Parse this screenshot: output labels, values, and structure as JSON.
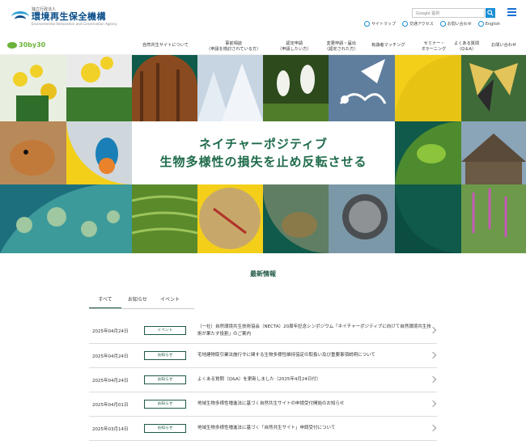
{
  "header": {
    "org_label": "独立行政法人",
    "org_name": "環境再生保全機構",
    "org_name_en": "Environmental Restoration and Conservation Agency",
    "search_placeholder": "Google 提供",
    "utility_links": [
      {
        "label": "サイトマップ",
        "icon": "sitemap-icon"
      },
      {
        "label": "交通アクセス",
        "icon": "map-pin-icon"
      },
      {
        "label": "お問い合わせ",
        "icon": "mail-icon"
      },
      {
        "label": "English",
        "icon": "globe-icon"
      }
    ]
  },
  "nav": {
    "logo_text": "30by30",
    "items": [
      {
        "label": "自然共生サイトについて",
        "sub": ""
      },
      {
        "label": "事前相談",
        "sub": "（申請を検討されている方）"
      },
      {
        "label": "認定申請",
        "sub": "（申請したい方）"
      },
      {
        "label": "変更申請・届出",
        "sub": "（認定された方）"
      },
      {
        "label": "有識者マッチング",
        "sub": ""
      },
      {
        "label": "セミナー・",
        "sub": "Eラーニング"
      },
      {
        "label": "よくある質問",
        "sub": "（Q＆A）"
      },
      {
        "label": "お問い合わせ",
        "sub": ""
      }
    ]
  },
  "hero": {
    "line1": "ネイチャーポジティブ",
    "line2": "生物多様性の損失を止め反転させる"
  },
  "news": {
    "title": "最新情報",
    "tabs": [
      "すべて",
      "お知らせ",
      "イベント"
    ],
    "items": [
      {
        "date": "2025年04月24日",
        "badge": "イベント",
        "text": "（一社）自然環境共生技術協会（NECTA）20周年記念シンポジウム「ネイチャーポジティブに向けて自然環境共生技術が果たす役割」のご案内"
      },
      {
        "date": "2025年04月24日",
        "badge": "お知らせ",
        "text": "宅地建物取引業法施行令に関する生物多様性維持協定の取扱い及び重要事項説明について"
      },
      {
        "date": "2025年04月24日",
        "badge": "お知らせ",
        "text": "よくある質問（Q&A）を更新しました（2025年4月24日付）"
      },
      {
        "date": "2025年04月01日",
        "badge": "お知らせ",
        "text": "地域生物多様性増進法に基づく自然共生サイトの申請受付開始のお知らせ"
      },
      {
        "date": "2025年03月14日",
        "badge": "お知らせ",
        "text": "地域生物多様性増進法に基づく「自然共生サイト」申請受付について"
      }
    ]
  },
  "colors": {
    "brand_green": "#1e5a44",
    "accent_blue": "#1a8fd6",
    "hero_yellow": "#f4cf1a",
    "hero_teal": "#0f5a4a"
  }
}
